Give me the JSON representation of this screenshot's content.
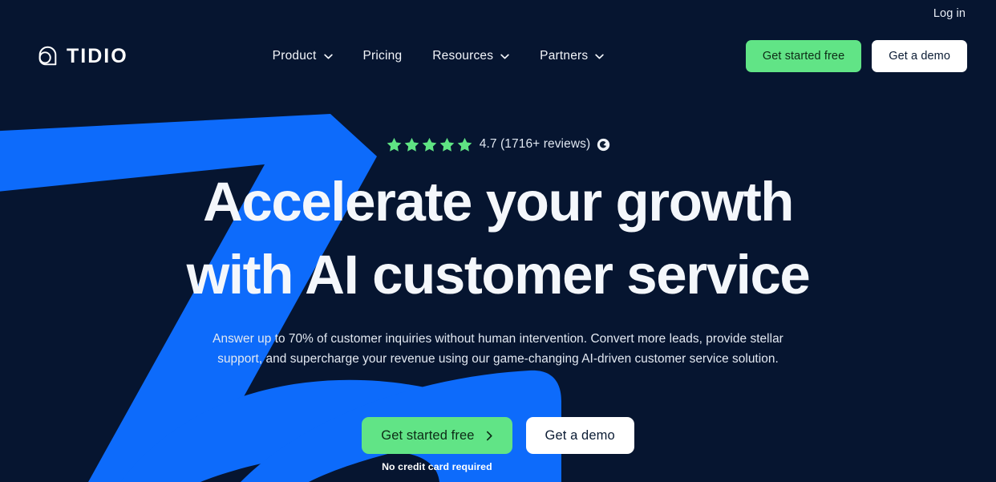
{
  "brand": {
    "name": "TIDIO",
    "logo_icon": "tidio-chat-bubble-icon",
    "colors": {
      "background": "#061530",
      "accent_blue": "#0d6bfb",
      "accent_green": "#61e486",
      "text_light": "#f4f7fb",
      "button_text_dark": "#0d2b16"
    }
  },
  "topbar": {
    "login_label": "Log in"
  },
  "nav": {
    "items": [
      {
        "label": "Product",
        "has_dropdown": true,
        "icon": "chevron-down-icon"
      },
      {
        "label": "Pricing",
        "has_dropdown": false,
        "icon": ""
      },
      {
        "label": "Resources",
        "has_dropdown": true,
        "icon": "chevron-down-icon"
      },
      {
        "label": "Partners",
        "has_dropdown": true,
        "icon": "chevron-down-icon"
      }
    ],
    "primary_cta": "Get started free",
    "secondary_cta": "Get a demo"
  },
  "hero": {
    "rating": {
      "stars_filled": 5,
      "star_icon": "star-icon",
      "score_text": "4.7 (1716+ reviews)",
      "source_badge_icon": "g2-badge-icon"
    },
    "headline_line1": "Accelerate your growth",
    "headline_line2": "with AI customer service",
    "subhead": "Answer up to 70% of customer inquiries without human intervention. Convert more leads, provide stellar support, and supercharge your revenue using our game-changing AI-driven customer service solution.",
    "primary_cta": "Get started free",
    "primary_cta_icon": "arrow-right-icon",
    "secondary_cta": "Get a demo",
    "disclaimer": "No credit card required"
  }
}
